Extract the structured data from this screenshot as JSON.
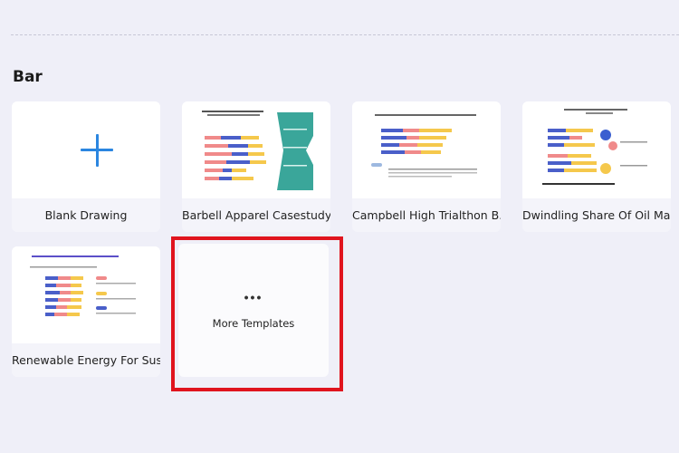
{
  "section": {
    "title": "Bar"
  },
  "templates": [
    {
      "label": "Blank Drawing",
      "icon": "plus-icon"
    },
    {
      "label": "Barbell Apparel Casestudy ..."
    },
    {
      "label": "Campbell High Trialthon B..."
    },
    {
      "label": "Dwindling Share Of Oil Ma..."
    },
    {
      "label": "Renewable Energy For Sust..."
    }
  ],
  "more_templates": {
    "dots": "•••",
    "label": "More Templates"
  },
  "colors": {
    "accent": "#2b86e0",
    "highlight": "#e0141e",
    "bar_blue": "#4a5fc9",
    "bar_red": "#f08a8a",
    "bar_yellow": "#f5c84c",
    "teal": "#3aa69a"
  }
}
